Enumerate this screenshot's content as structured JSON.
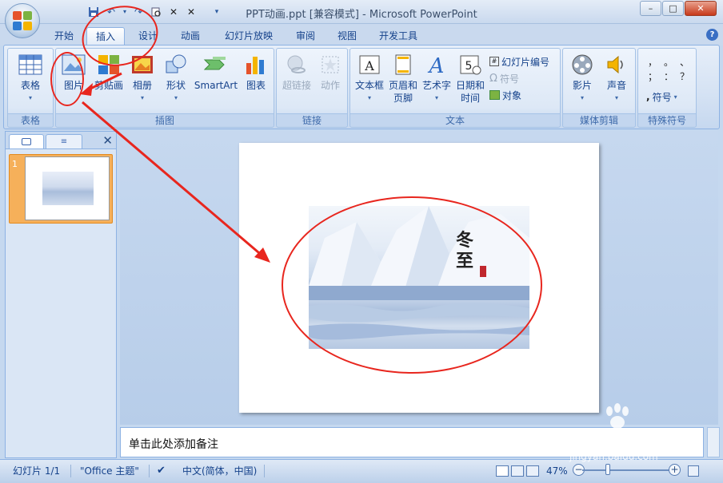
{
  "window": {
    "title": "PPT动画.ppt [兼容模式] - Microsoft PowerPoint",
    "minimize": "–",
    "maximize": "□",
    "close": "✕"
  },
  "tabs": [
    "开始",
    "插入",
    "设计",
    "动画",
    "幻灯片放映",
    "审阅",
    "视图",
    "开发工具"
  ],
  "active_tab": "插入",
  "ribbon": {
    "groups": {
      "table": "表格",
      "illustrations": "插图",
      "links": "链接",
      "text": "文本",
      "media": "媒体剪辑",
      "symbols": "特殊符号"
    },
    "buttons": {
      "table": "表格",
      "picture": "图片",
      "clipart": "剪贴画",
      "photo_album": "相册",
      "shapes": "形状",
      "smartart": "SmartArt",
      "chart": "图表",
      "hyperlink": "超链接",
      "action": "动作",
      "textbox": "文本框",
      "header_footer_1": "页眉和",
      "header_footer_2": "页脚",
      "wordart": "艺术字",
      "datetime_1": "日期和",
      "datetime_2": "时间",
      "slide_number": "幻灯片编号",
      "symbol": "符号",
      "object": "对象",
      "movie": "影片",
      "sound": "声音",
      "special_symbol": "符号"
    },
    "punct_glyphs": [
      "，",
      "。",
      "、",
      "；",
      "：",
      "？"
    ]
  },
  "slide_panel": {
    "slide_index": "1"
  },
  "slide": {
    "picture_title": "冬至"
  },
  "notes": {
    "placeholder": "单击此处添加备注"
  },
  "status": {
    "slide_count": "幻灯片 1/1",
    "theme": "\"Office 主题\"",
    "language": "中文(简体，中国)",
    "zoom": "47%"
  },
  "watermark": {
    "logo": "Baidu经验",
    "url": "jingyan.baidu.com"
  },
  "colors": {
    "accent": "#15428b",
    "annotation": "#e8261e",
    "thumb_highlight": "#f6b05a"
  }
}
